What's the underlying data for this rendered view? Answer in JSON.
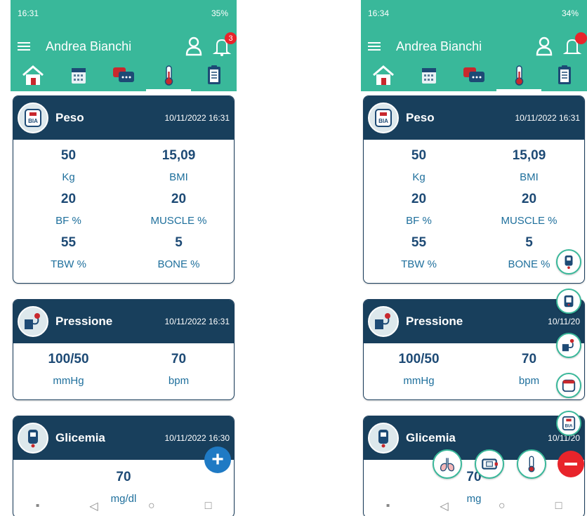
{
  "left": {
    "status": {
      "time": "16:31",
      "battery": "35%"
    },
    "appbar": {
      "user_name": "Andrea Bianchi",
      "notifications": "3"
    },
    "cards": {
      "peso": {
        "title": "Peso",
        "date": "10/11/2022 16:31",
        "values": [
          {
            "value": "50",
            "unit": "Kg"
          },
          {
            "value": "15,09",
            "unit": "BMI"
          },
          {
            "value": "20",
            "unit": "BF %"
          },
          {
            "value": "20",
            "unit": "MUSCLE %"
          },
          {
            "value": "55",
            "unit": "TBW %"
          },
          {
            "value": "5",
            "unit": "BONE %"
          }
        ]
      },
      "pressione": {
        "title": "Pressione",
        "date": "10/11/2022 16:31",
        "values": [
          {
            "value": "100/50",
            "unit": "mmHg"
          },
          {
            "value": "70",
            "unit": "bpm"
          }
        ]
      },
      "glicemia": {
        "title": "Glicemia",
        "date": "10/11/2022 16:30",
        "value": "70",
        "unit": "mg/dl"
      }
    },
    "fab_label": "+"
  },
  "right": {
    "status": {
      "time": "16:34",
      "battery": "34%"
    },
    "appbar": {
      "user_name": "Andrea Bianchi"
    },
    "cards": {
      "peso": {
        "title": "Peso",
        "date": "10/11/2022 16:31",
        "values": [
          {
            "value": "50",
            "unit": "Kg"
          },
          {
            "value": "15,09",
            "unit": "BMI"
          },
          {
            "value": "20",
            "unit": "BF %"
          },
          {
            "value": "20",
            "unit": "MUSCLE %"
          },
          {
            "value": "55",
            "unit": "TBW %"
          },
          {
            "value": "5",
            "unit": "BONE %"
          }
        ]
      },
      "pressione": {
        "title": "Pressione",
        "date": "10/11/20",
        "values": [
          {
            "value": "100/50",
            "unit": "mmHg"
          },
          {
            "value": "70",
            "unit": "bpm"
          }
        ]
      },
      "glicemia": {
        "title": "Glicemia",
        "date": "10/11/20",
        "value": "70",
        "unit": "mg"
      }
    }
  },
  "colors": {
    "primary": "#39b89a",
    "card_header": "#183f5c",
    "value": "#1d4a75",
    "unit": "#1e6f9c",
    "fab": "#1f7ac4",
    "badge": "#e8242b"
  },
  "icons": [
    "menu-icon",
    "user-icon",
    "bell-icon",
    "home-icon",
    "calendar-icon",
    "chat-icon",
    "thermometer-icon",
    "clipboard-icon",
    "bia-scale-icon",
    "blood-pressure-icon",
    "glucometer-icon",
    "lungs-icon",
    "ecg-icon",
    "minus-icon"
  ]
}
